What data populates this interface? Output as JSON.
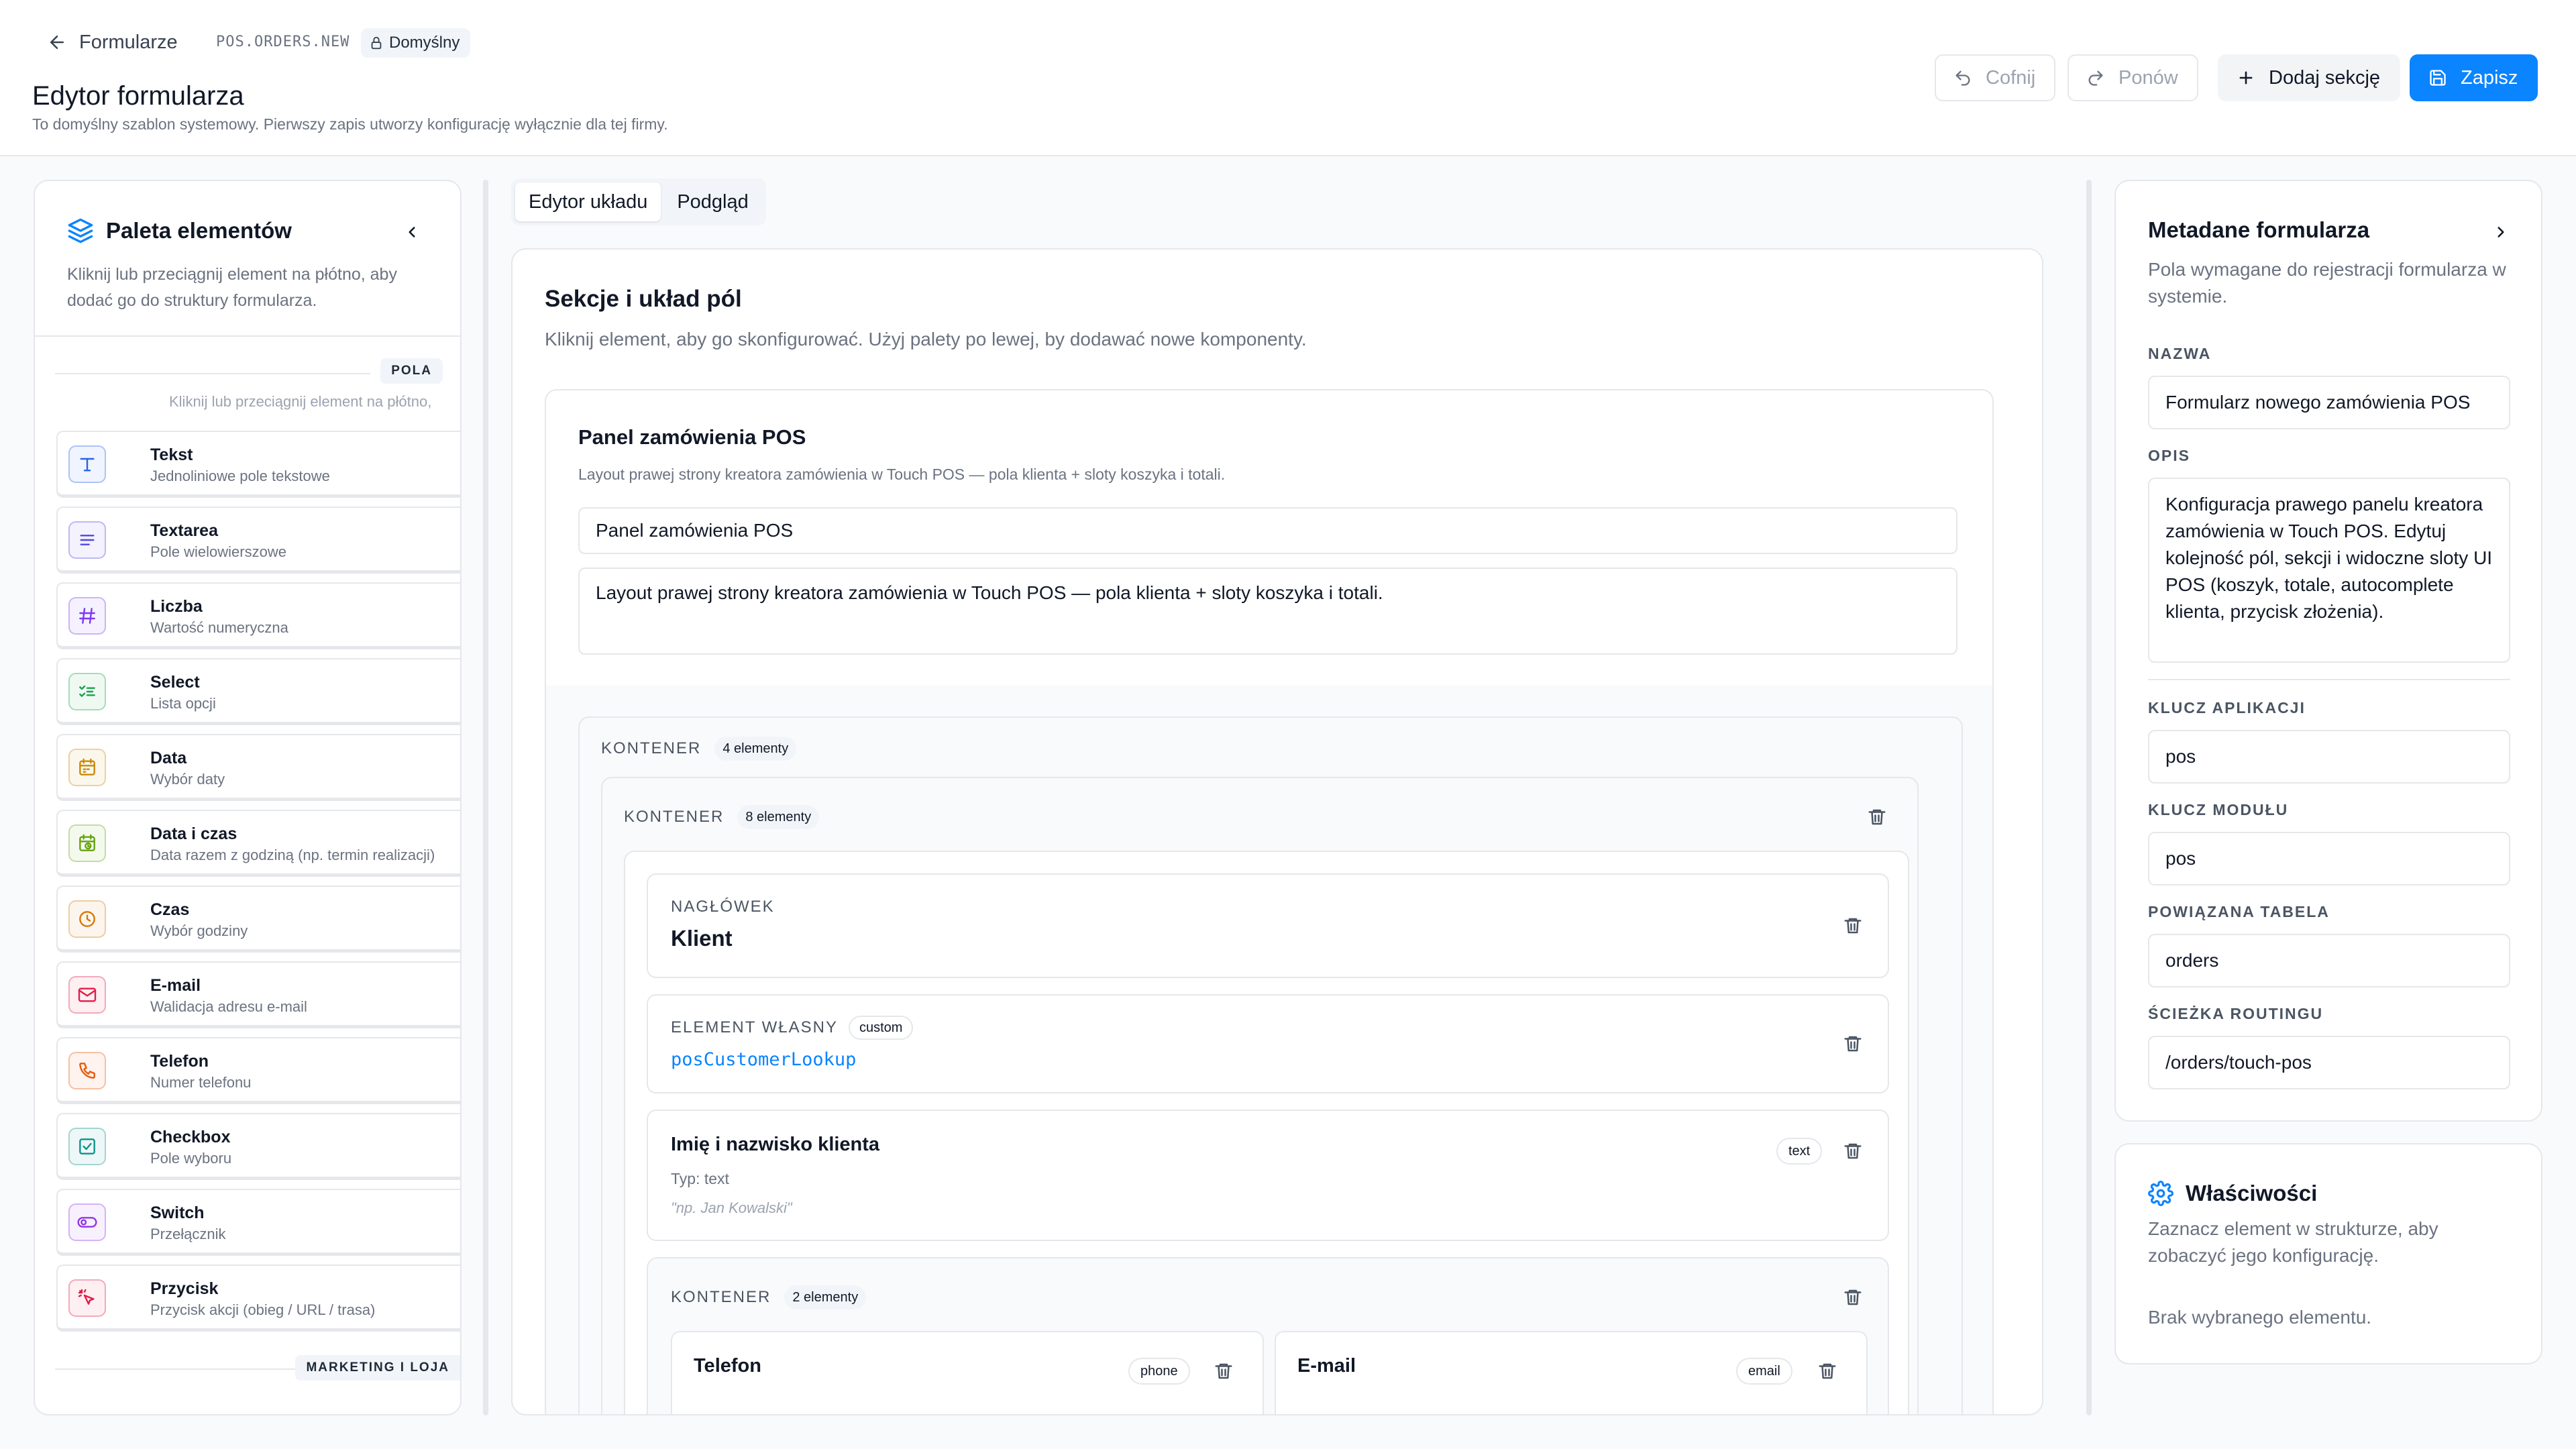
{
  "header": {
    "breadcrumb_label": "Formularze",
    "form_code": "POS.ORDERS.NEW",
    "default_badge": "Domyślny",
    "title": "Edytor formularza",
    "subtitle": "To domyślny szablon systemowy. Pierwszy zapis utworzy konfigurację wyłącznie dla tej firmy.",
    "undo_label": "Cofnij",
    "redo_label": "Ponów",
    "add_section_label": "Dodaj sekcję",
    "save_label": "Zapisz"
  },
  "palette": {
    "title": "Paleta elementów",
    "description": "Kliknij lub przeciągnij element na płótno, aby dodać go do struktury formularza.",
    "section_fields_label": "POLA",
    "section_hint": "Kliknij lub przeciągnij element na płótno,",
    "section_next_label": "MARKETING I LOJA",
    "items": [
      {
        "name": "Tekst",
        "desc": "Jednoliniowe pole tekstowe",
        "icon": "text-icon",
        "color": "#2563eb"
      },
      {
        "name": "Textarea",
        "desc": "Pole wielowierszowe",
        "icon": "align-left-icon",
        "color": "#4f46e5"
      },
      {
        "name": "Liczba",
        "desc": "Wartość numeryczna",
        "icon": "hash-icon",
        "color": "#7c3aed"
      },
      {
        "name": "Select",
        "desc": "Lista opcji",
        "icon": "list-check-icon",
        "color": "#16a34a"
      },
      {
        "name": "Data",
        "desc": "Wybór daty",
        "icon": "calendar-icon",
        "color": "#ca8a04"
      },
      {
        "name": "Data i czas",
        "desc": "Data razem z godziną (np. termin realizacji)",
        "icon": "calendar-clock-icon",
        "color": "#65a30d"
      },
      {
        "name": "Czas",
        "desc": "Wybór godziny",
        "icon": "clock-icon",
        "color": "#d97706"
      },
      {
        "name": "E-mail",
        "desc": "Walidacja adresu e-mail",
        "icon": "mail-icon",
        "color": "#e11d48"
      },
      {
        "name": "Telefon",
        "desc": "Numer telefonu",
        "icon": "phone-icon",
        "color": "#ea580c"
      },
      {
        "name": "Checkbox",
        "desc": "Pole wyboru",
        "icon": "checkbox-icon",
        "color": "#0d9488"
      },
      {
        "name": "Switch",
        "desc": "Przełącznik",
        "icon": "toggle-icon",
        "color": "#9333ea"
      },
      {
        "name": "Przycisk",
        "desc": "Przycisk akcji (obieg / URL / trasa)",
        "icon": "pointer-click-icon",
        "color": "#e11d48"
      }
    ]
  },
  "tabs": [
    "Edytor układu",
    "Podgląd"
  ],
  "canvas": {
    "title": "Sekcje i układ pól",
    "subtitle": "Kliknij element, aby go skonfigurować. Użyj palety po lewej, by dodawać nowe komponenty.",
    "section": {
      "name": "Panel zamówienia POS",
      "description": "Layout prawej strony kreatora zamówienia w Touch POS — pola klienta + sloty koszyka i totali.",
      "name_value": "Panel zamówienia POS",
      "description_value": "Layout prawej strony kreatora zamówienia w Touch POS — pola klienta + sloty koszyka i totali."
    },
    "outer_container": {
      "label": "KONTENER",
      "count": "4 elementy"
    },
    "inner_container": {
      "label": "KONTENER",
      "count": "8 elementy"
    },
    "heading_card": {
      "kicker": "NAGŁÓWEK",
      "text": "Klient"
    },
    "custom_card": {
      "kicker": "ELEMENT WŁASNY",
      "badge": "custom",
      "component": "posCustomerLookup"
    },
    "field_card": {
      "label": "Imię i nazwisko klienta",
      "type_badge": "text",
      "type_line": "Typ: text",
      "placeholder": "\"np. Jan Kowalski\""
    },
    "nested_container": {
      "label": "KONTENER",
      "count": "2 elementy"
    },
    "phone_card": {
      "label": "Telefon",
      "type_badge": "phone"
    },
    "email_card": {
      "label": "E-mail",
      "type_badge": "email"
    }
  },
  "metadata": {
    "title": "Metadane formularza",
    "description": "Pola wymagane do rejestracji formularza w systemie.",
    "name_label": "NAZWA",
    "name_value": "Formularz nowego zamówienia POS",
    "desc_label": "OPIS",
    "desc_value": "Konfiguracja prawego panelu kreatora zamówienia w Touch POS. Edytuj kolejność pól, sekcji i widoczne sloty UI POS (koszyk, totale, autocomplete klienta, przycisk złożenia).",
    "app_key_label": "KLUCZ APLIKACJI",
    "app_key_value": "pos",
    "module_key_label": "KLUCZ MODUŁU",
    "module_key_value": "pos",
    "table_label": "POWIĄZANA TABELA",
    "table_value": "orders",
    "route_label": "ŚCIEŻKA ROUTINGU",
    "route_value": "/orders/touch-pos"
  },
  "properties": {
    "title": "Właściwości",
    "description": "Zaznacz element w strukturze, aby zobaczyć jego konfigurację.",
    "empty": "Brak wybranego elementu."
  },
  "colors": {
    "accent": "#0a84ff",
    "border": "#e5e7eb",
    "muted": "#6b7280"
  }
}
